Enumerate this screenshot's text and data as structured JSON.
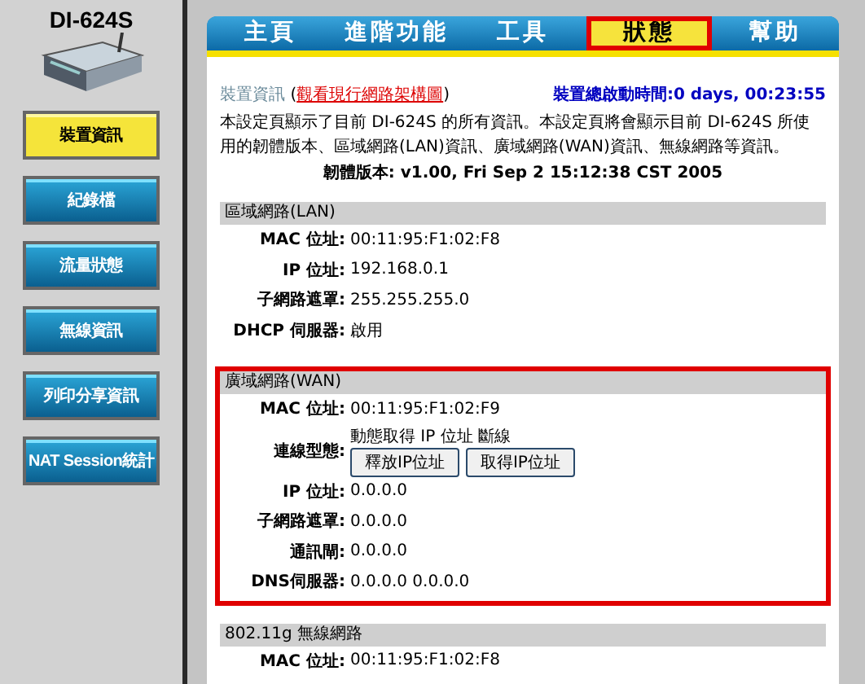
{
  "product": {
    "model": "DI-624S"
  },
  "sidebar": {
    "items": [
      {
        "label": "裝置資訊",
        "selected": true
      },
      {
        "label": "紀錄檔",
        "selected": false
      },
      {
        "label": "流量狀態",
        "selected": false
      },
      {
        "label": "無線資訊",
        "selected": false
      },
      {
        "label": "列印分享資訊",
        "selected": false
      },
      {
        "label": "NAT Session統計",
        "selected": false
      }
    ]
  },
  "tabs": [
    {
      "label": "主頁",
      "selected": false,
      "highlighted": false
    },
    {
      "label": "進階功能",
      "selected": false,
      "highlighted": false
    },
    {
      "label": "工具",
      "selected": false,
      "highlighted": false
    },
    {
      "label": "狀態",
      "selected": true,
      "highlighted": true
    },
    {
      "label": "幫助",
      "selected": false,
      "highlighted": false
    }
  ],
  "device_info": {
    "title": "裝置資訊",
    "link_open": "(",
    "link": "觀看現行網路架構圖",
    "link_close": ")",
    "uptime": "裝置總啟動時間:0 days, 00:23:55",
    "description": "本設定頁顯示了目前 DI-624S 的所有資訊。本設定頁將會顯示目前 DI-624S 所使用的韌體版本、區域網路(LAN)資訊、廣域網路(WAN)資訊、無線網路等資訊。",
    "firmware": "韌體版本: v1.00, Fri Sep 2 15:12:38 CST 2005"
  },
  "sections": [
    {
      "title": "區域網路(LAN)",
      "highlighted": false,
      "rows": [
        {
          "label": "MAC 位址:",
          "value": "00:11:95:F1:02:F8"
        },
        {
          "label": "IP 位址:",
          "value": "192.168.0.1"
        },
        {
          "label": "子網路遮罩:",
          "value": "255.255.255.0"
        },
        {
          "label": "DHCP 伺服器:",
          "value": "啟用"
        }
      ]
    },
    {
      "title": "廣域網路(WAN)",
      "highlighted": true,
      "rows": [
        {
          "label": "MAC 位址:",
          "value": "00:11:95:F1:02:F9"
        },
        {
          "label": "連線型態:",
          "value": "動態取得 IP 位址 斷線",
          "buttons": [
            "釋放IP位址",
            "取得IP位址"
          ]
        },
        {
          "label": "IP 位址:",
          "value": "0.0.0.0"
        },
        {
          "label": "子網路遮罩:",
          "value": "0.0.0.0"
        },
        {
          "label": "通訊閘:",
          "value": "0.0.0.0"
        },
        {
          "label": "DNS伺服器:",
          "value": "0.0.0.0 0.0.0.0"
        }
      ]
    },
    {
      "title": "802.11g 無線網路",
      "highlighted": false,
      "rows": [
        {
          "label": "MAC 位址:",
          "value": "00:11:95:F1:02:F8"
        }
      ]
    }
  ]
}
